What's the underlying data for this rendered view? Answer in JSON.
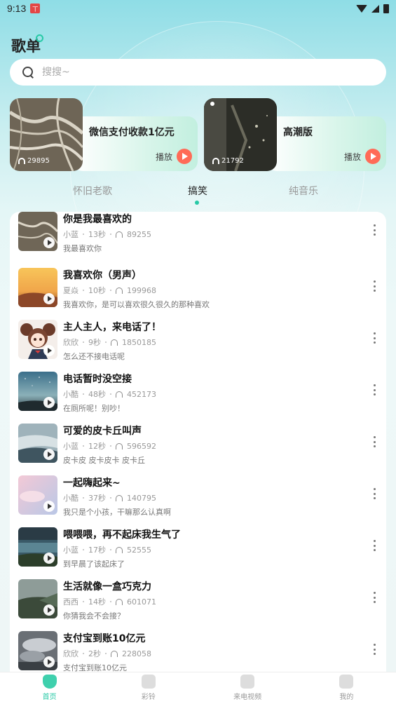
{
  "status": {
    "time": "9:13",
    "notif_badge": "ㄒ"
  },
  "header": {
    "title": "歌单"
  },
  "search": {
    "placeholder": "搜搜~"
  },
  "featured": [
    {
      "name": "微信支付收款1亿元",
      "count": "29895",
      "play_label": "播放",
      "cover": "river"
    },
    {
      "name": "高潮版",
      "count": "21792",
      "play_label": "播放",
      "cover": "dark-forest"
    }
  ],
  "tabs": [
    {
      "label": "怀旧老歌"
    },
    {
      "label": "搞笑"
    },
    {
      "label": "纯音乐"
    }
  ],
  "tabs_active": "搞笑",
  "list": [
    {
      "title": "你是我最喜欢的",
      "author": "小蓝",
      "duration": "13秒",
      "plays": "89255",
      "desc": "我最喜欢你",
      "thumb": "river"
    },
    {
      "title": "我喜欢你（男声）",
      "author": "夏焱",
      "duration": "10秒",
      "plays": "199968",
      "desc": "我喜欢你，是可以喜欢很久很久的那种喜欢",
      "thumb": "sunset"
    },
    {
      "title": "主人主人，来电话了！",
      "author": "欣欣",
      "duration": "9秒",
      "plays": "1850185",
      "desc": "怎么还不接电话呢",
      "thumb": "anime"
    },
    {
      "title": "电话暂时没空接",
      "author": "小酷",
      "duration": "48秒",
      "plays": "452173",
      "desc": "在厕所呢！别吵！",
      "thumb": "stars"
    },
    {
      "title": "可爱的皮卡丘叫声",
      "author": "小蓝",
      "duration": "12秒",
      "plays": "596592",
      "desc": "皮卡皮 皮卡皮卡 皮卡丘",
      "thumb": "mist"
    },
    {
      "title": "一起嗨起来~",
      "author": "小酷",
      "duration": "37秒",
      "plays": "140795",
      "desc": "我只是个小孩，干嘛那么认真啊",
      "thumb": "pink"
    },
    {
      "title": "喂喂喂，再不起床我生气了",
      "author": "小蓝",
      "duration": "17秒",
      "plays": "52555",
      "desc": "到早晨了该起床了",
      "thumb": "lake"
    },
    {
      "title": "生活就像一盒巧克力",
      "author": "西西",
      "duration": "14秒",
      "plays": "601071",
      "desc": "你猜我会不会接？",
      "thumb": "coast"
    },
    {
      "title": "支付宝到账10亿元",
      "author": "欣欣",
      "duration": "2秒",
      "plays": "228058",
      "desc": "支付宝到账10亿元",
      "thumb": "clouds"
    }
  ],
  "bottom_nav": [
    {
      "label": "首页",
      "icon": "home-icon",
      "active": true
    },
    {
      "label": "彩铃",
      "icon": "bell-icon",
      "active": false
    },
    {
      "label": "来电视频",
      "icon": "phone-icon",
      "active": false
    },
    {
      "label": "我的",
      "icon": "profile-icon",
      "active": false
    }
  ],
  "colors": {
    "accent": "#27c9a6",
    "play": "#ff6b57"
  }
}
